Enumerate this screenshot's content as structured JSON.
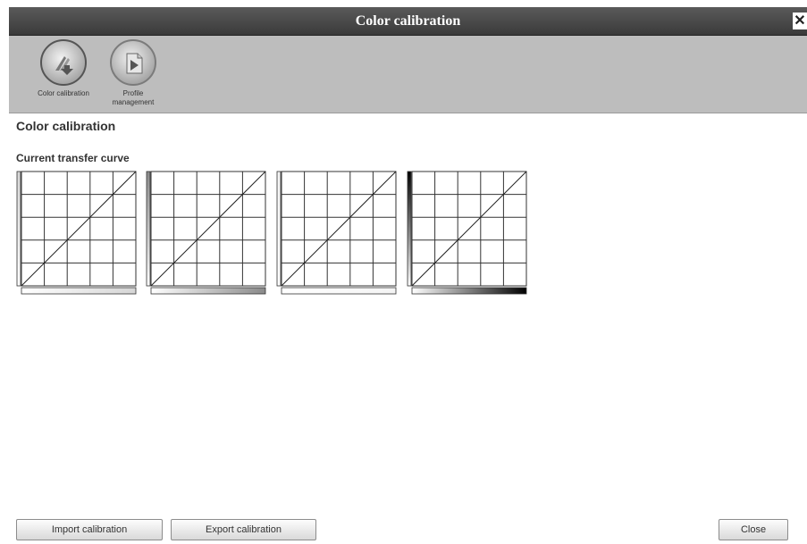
{
  "window": {
    "title": "Color calibration",
    "close_glyph": "✕"
  },
  "toolbar": {
    "items": [
      {
        "label": "Color calibration",
        "icon": "color-calibration-icon",
        "active": true
      },
      {
        "label": "Profile management",
        "icon": "profile-management-icon",
        "active": false
      }
    ]
  },
  "main": {
    "section_title": "Color calibration",
    "curve_title": "Current transfer curve",
    "curves": [
      {
        "channel": "cyan-gradient",
        "ramp_end": "#d6d6d6"
      },
      {
        "channel": "magenta-gradient",
        "ramp_end": "#8a8a8a"
      },
      {
        "channel": "yellow-gradient",
        "ramp_end": "#f4f4f4"
      },
      {
        "channel": "black-gradient",
        "ramp_end": "#000000"
      }
    ]
  },
  "footer": {
    "import_label": "Import calibration",
    "export_label": "Export calibration",
    "close_label": "Close"
  }
}
